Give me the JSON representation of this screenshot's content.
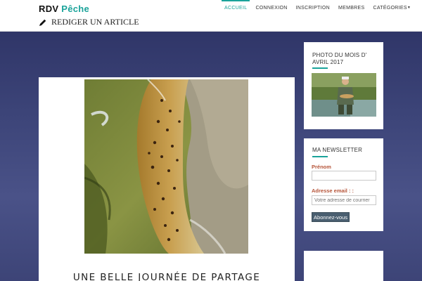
{
  "site": {
    "brand_part1": "RDV",
    "brand_part2": "Pêche",
    "write_link": "REDIGER UN ARTICLE",
    "accent_color": "#1aa39a"
  },
  "nav": {
    "items": [
      {
        "label": "ACCUEIL",
        "active": true
      },
      {
        "label": "CONNEXION",
        "active": false
      },
      {
        "label": "INSCRIPTION",
        "active": false
      },
      {
        "label": "MEMBRES",
        "active": false
      },
      {
        "label": "CATÉGORIES",
        "active": false,
        "dropdown": true
      }
    ],
    "dropdown_icon": "caret-down-icon"
  },
  "article": {
    "title": "UNE BELLE JOURNÉE DE PARTAGE",
    "photo_subject": "brown trout in hand"
  },
  "sidebar": {
    "photo_widget": {
      "title": "PHOTO DU MOIS D' AVRIL 2017",
      "photo_subject": "angler holding fish by river"
    },
    "newsletter": {
      "title": "MA NEWSLETTER",
      "firstname_label": "Prénom",
      "firstname_value": "",
      "email_label": "Adresse email : :",
      "email_placeholder": "Votre adresse de courrier",
      "submit_label": "Abonnez-vous"
    }
  }
}
